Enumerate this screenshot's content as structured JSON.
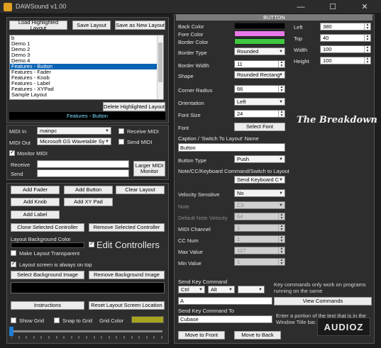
{
  "window": {
    "title": "DAWSound v1.00",
    "minimize_glyph": "—",
    "maximize_glyph": "☐",
    "close_glyph": "✕"
  },
  "layout_panel": {
    "load_button": "Load Highlighted Layout",
    "save_button": "Save Layout",
    "save_new_button": "Save as New Layout",
    "layouts": [
      "b",
      "Demo 1",
      "Demo 2",
      "Demo 3",
      "Demo 4",
      "Features - Button",
      "Features - Fader",
      "Features - Knob",
      "Features - Label",
      "Features - XYPad",
      "Sample Layout"
    ],
    "selected_index": 5,
    "delete_button": "Delete Highlighted Layout",
    "current_layout": "Features - Button"
  },
  "midi_panel": {
    "midi_in_label": "MIDI In",
    "midi_in_value": "mainpc",
    "receive_midi_label": "Receive MIDI",
    "midi_out_label": "MIDI Out",
    "midi_out_value": "Microsoft GS Wavetable Sy",
    "send_midi_label": "Send MIDI",
    "monitor_midi_label": "Monitor MIDI",
    "receive_label": "Receive",
    "send_label": "Send",
    "larger_monitor_button": "Larger MIDI Monitor"
  },
  "controls_panel": {
    "add_fader": "Add Fader",
    "add_button": "Add Button",
    "clear_layout": "Clear Layout",
    "add_knob": "Add Knob",
    "add_xy_pad": "Add XY Pad",
    "add_label": "Add Label",
    "clone_selected": "Clone Selected Controller",
    "remove_selected": "Remove Selected Controller",
    "background_color_label": "Layout Background Color",
    "edit_controllers_label": "Edit Controllers",
    "make_transparent_label": "Make Layout Transparent",
    "always_on_top_label": "Layout screen is always on top",
    "select_bg_image": "Select Background Image",
    "remove_bg_image": "Remove Background Image",
    "instructions": "Instructions",
    "reset_location": "Reset Layout Screen Location",
    "show_grid_label": "Show Grid",
    "snap_to_grid_label": "Snap to Grid",
    "grid_color_label": "Grid Color",
    "grid_color": "#a8a41e"
  },
  "properties": {
    "header": "BUTTON",
    "back_color_label": "Back Color",
    "back_color": "#000000",
    "fore_color_label": "Fore Color",
    "fore_color": "#e87ae8",
    "border_color_label": "Border Color",
    "border_color": "#3ec83e",
    "border_type_label": "Border Type",
    "border_type": "Rounded",
    "border_width_label": "Border Width",
    "border_width": "11",
    "shape_label": "Shape",
    "shape": "Rounded Rectang",
    "corner_radius_label": "Corner Radius",
    "corner_radius": "66",
    "orientation_label": "Orientation",
    "orientation": "Left",
    "font_size_label": "Font Size",
    "font_size": "24",
    "font_label": "Font",
    "select_font_button": "Select Font",
    "caption_label": "Caption / 'Switch To Layout' Name",
    "caption_value": "Button",
    "button_type_label": "Button Type",
    "button_type": "Push",
    "command_label": "Note/CC/Keyboard Command/Switch to Layout",
    "command_value": "Send Keyboard C",
    "velocity_sensitive_label": "Velocity Sensitive",
    "velocity_sensitive": "No",
    "note_label": "Note",
    "note_value": "C3",
    "default_velocity_label": "Default Note Velocity",
    "default_velocity": "64",
    "midi_channel_label": "MIDI Channel",
    "midi_channel": "1",
    "cc_num_label": "CC Num",
    "cc_num": "1",
    "max_value_label": "Max Value",
    "max_value": "127",
    "min_value_label": "Min Value",
    "min_value": "1",
    "left_label": "Left",
    "left_value": "380",
    "top_label": "Top",
    "top_value": "40",
    "width_label": "Width",
    "width_value": "100",
    "height_label": "Height",
    "height_value": "100",
    "preview_text": "The Breakdown",
    "send_key_label": "Send Key Command",
    "key_modifier1": "Ctrl",
    "key_modifier2": "Alt",
    "key_modifier3": "",
    "key_value": "A",
    "key_note": "Key commands only work on programs running on the same",
    "view_commands_button": "View Commands",
    "send_key_to_label": "Send Key Command To",
    "send_key_to_value": "Cubase",
    "send_to_note": "Enter a portion of the text that is in the Window Title bar.",
    "move_front_button": "Move to Front",
    "move_back_button": "Move to Back"
  },
  "watermark": "AUDIOZ"
}
